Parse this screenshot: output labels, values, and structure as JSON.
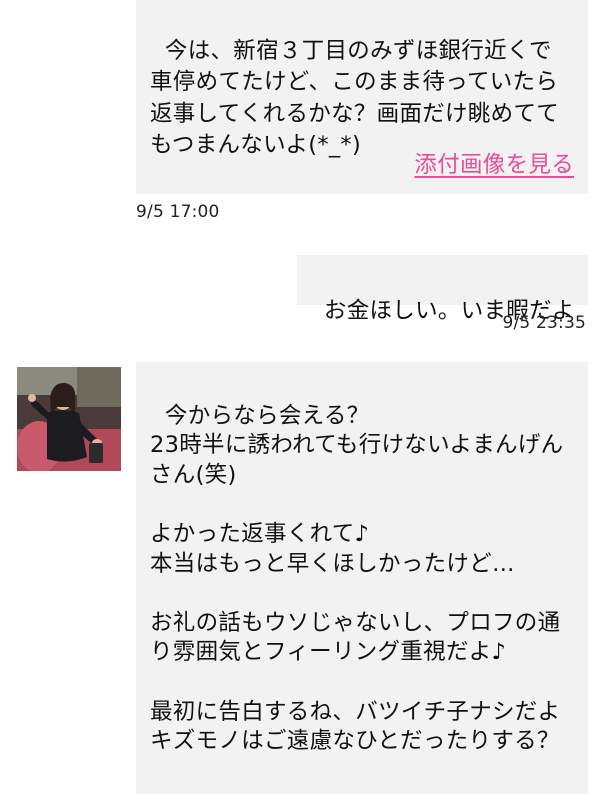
{
  "messages": [
    {
      "text": "今は、新宿３丁目のみずほ銀行近くで車停めてたけど、このまま待っていたら返事してくれるかな？画面だけ眺めててもつまんないよ(*_*)",
      "attachment_label": "添付画像を見る",
      "timestamp": "9/5 17:00"
    },
    {
      "text": "お金ほしい。いま暇だよ",
      "timestamp": "9/5 23:35"
    },
    {
      "text": "今からなら会える？\n23時半に誘われても行けないよまんげんさん(笑)\n\nよかった返事くれて♪\n本当はもっと早くほしかったけど…\n\nお礼の話もウソじゃないし、プロフの通り雰囲気とフィーリング重視だよ♪\n\n最初に告白するね、バツイチ子ナシだよ\nキズモノはご遠慮なひとだったりする？"
    }
  ],
  "colors": {
    "bubble_bg": "#f2f2f2",
    "link": "#ea4c9a",
    "text": "#111111"
  }
}
